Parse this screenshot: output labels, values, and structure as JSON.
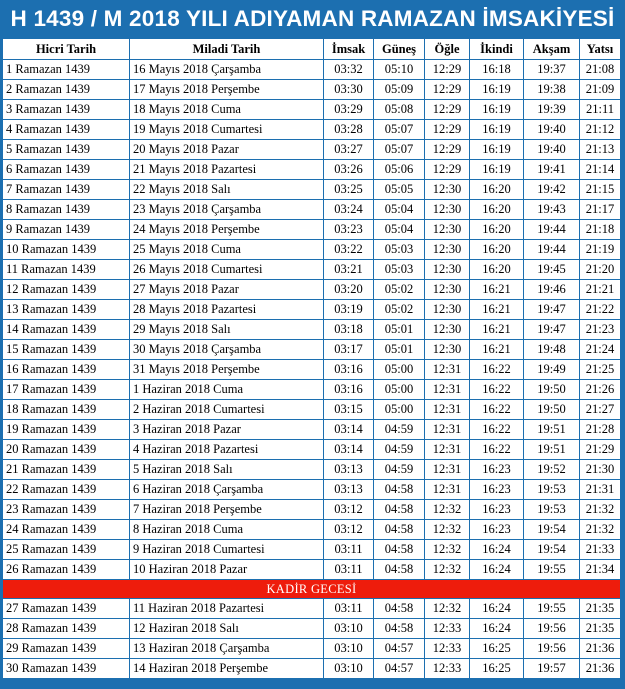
{
  "title": "H 1439 / M 2018 YILI ADIYAMAN RAMAZAN İMSAKİYESİ",
  "headers": {
    "hijri": "Hicri Tarih",
    "gregorian": "Miladi Tarih",
    "imsak": "İmsak",
    "gunes": "Güneş",
    "ogle": "Öğle",
    "ikindi": "İkindi",
    "aksam": "Akşam",
    "yatsi": "Yatsı"
  },
  "special_row": {
    "after_index": 25,
    "label": "KADİR GECESİ"
  },
  "rows": [
    {
      "hijri": "1 Ramazan 1439",
      "gregorian": "16 Mayıs 2018 Çarşamba",
      "imsak": "03:32",
      "gunes": "05:10",
      "ogle": "12:29",
      "ikindi": "16:18",
      "aksam": "19:37",
      "yatsi": "21:08"
    },
    {
      "hijri": "2 Ramazan 1439",
      "gregorian": "17 Mayıs 2018 Perşembe",
      "imsak": "03:30",
      "gunes": "05:09",
      "ogle": "12:29",
      "ikindi": "16:19",
      "aksam": "19:38",
      "yatsi": "21:09"
    },
    {
      "hijri": "3 Ramazan 1439",
      "gregorian": "18 Mayıs 2018 Cuma",
      "imsak": "03:29",
      "gunes": "05:08",
      "ogle": "12:29",
      "ikindi": "16:19",
      "aksam": "19:39",
      "yatsi": "21:11"
    },
    {
      "hijri": "4 Ramazan 1439",
      "gregorian": "19 Mayıs 2018 Cumartesi",
      "imsak": "03:28",
      "gunes": "05:07",
      "ogle": "12:29",
      "ikindi": "16:19",
      "aksam": "19:40",
      "yatsi": "21:12"
    },
    {
      "hijri": "5 Ramazan 1439",
      "gregorian": "20 Mayıs 2018 Pazar",
      "imsak": "03:27",
      "gunes": "05:07",
      "ogle": "12:29",
      "ikindi": "16:19",
      "aksam": "19:40",
      "yatsi": "21:13"
    },
    {
      "hijri": "6 Ramazan 1439",
      "gregorian": "21 Mayıs 2018 Pazartesi",
      "imsak": "03:26",
      "gunes": "05:06",
      "ogle": "12:29",
      "ikindi": "16:19",
      "aksam": "19:41",
      "yatsi": "21:14"
    },
    {
      "hijri": "7 Ramazan 1439",
      "gregorian": "22 Mayıs 2018 Salı",
      "imsak": "03:25",
      "gunes": "05:05",
      "ogle": "12:30",
      "ikindi": "16:20",
      "aksam": "19:42",
      "yatsi": "21:15"
    },
    {
      "hijri": "8 Ramazan 1439",
      "gregorian": "23 Mayıs 2018 Çarşamba",
      "imsak": "03:24",
      "gunes": "05:04",
      "ogle": "12:30",
      "ikindi": "16:20",
      "aksam": "19:43",
      "yatsi": "21:17"
    },
    {
      "hijri": "9 Ramazan 1439",
      "gregorian": "24 Mayıs 2018 Perşembe",
      "imsak": "03:23",
      "gunes": "05:04",
      "ogle": "12:30",
      "ikindi": "16:20",
      "aksam": "19:44",
      "yatsi": "21:18"
    },
    {
      "hijri": "10 Ramazan 1439",
      "gregorian": "25 Mayıs 2018 Cuma",
      "imsak": "03:22",
      "gunes": "05:03",
      "ogle": "12:30",
      "ikindi": "16:20",
      "aksam": "19:44",
      "yatsi": "21:19"
    },
    {
      "hijri": "11 Ramazan 1439",
      "gregorian": "26 Mayıs 2018 Cumartesi",
      "imsak": "03:21",
      "gunes": "05:03",
      "ogle": "12:30",
      "ikindi": "16:20",
      "aksam": "19:45",
      "yatsi": "21:20"
    },
    {
      "hijri": "12 Ramazan 1439",
      "gregorian": "27 Mayıs 2018 Pazar",
      "imsak": "03:20",
      "gunes": "05:02",
      "ogle": "12:30",
      "ikindi": "16:21",
      "aksam": "19:46",
      "yatsi": "21:21"
    },
    {
      "hijri": "13 Ramazan 1439",
      "gregorian": "28 Mayıs 2018 Pazartesi",
      "imsak": "03:19",
      "gunes": "05:02",
      "ogle": "12:30",
      "ikindi": "16:21",
      "aksam": "19:47",
      "yatsi": "21:22"
    },
    {
      "hijri": "14 Ramazan 1439",
      "gregorian": "29 Mayıs 2018 Salı",
      "imsak": "03:18",
      "gunes": "05:01",
      "ogle": "12:30",
      "ikindi": "16:21",
      "aksam": "19:47",
      "yatsi": "21:23"
    },
    {
      "hijri": "15 Ramazan 1439",
      "gregorian": "30 Mayıs 2018 Çarşamba",
      "imsak": "03:17",
      "gunes": "05:01",
      "ogle": "12:30",
      "ikindi": "16:21",
      "aksam": "19:48",
      "yatsi": "21:24"
    },
    {
      "hijri": "16 Ramazan 1439",
      "gregorian": "31 Mayıs 2018 Perşembe",
      "imsak": "03:16",
      "gunes": "05:00",
      "ogle": "12:31",
      "ikindi": "16:22",
      "aksam": "19:49",
      "yatsi": "21:25"
    },
    {
      "hijri": "17 Ramazan 1439",
      "gregorian": "1 Haziran 2018 Cuma",
      "imsak": "03:16",
      "gunes": "05:00",
      "ogle": "12:31",
      "ikindi": "16:22",
      "aksam": "19:50",
      "yatsi": "21:26"
    },
    {
      "hijri": "18 Ramazan 1439",
      "gregorian": "2 Haziran 2018 Cumartesi",
      "imsak": "03:15",
      "gunes": "05:00",
      "ogle": "12:31",
      "ikindi": "16:22",
      "aksam": "19:50",
      "yatsi": "21:27"
    },
    {
      "hijri": "19 Ramazan 1439",
      "gregorian": "3 Haziran 2018 Pazar",
      "imsak": "03:14",
      "gunes": "04:59",
      "ogle": "12:31",
      "ikindi": "16:22",
      "aksam": "19:51",
      "yatsi": "21:28"
    },
    {
      "hijri": "20 Ramazan 1439",
      "gregorian": "4 Haziran 2018 Pazartesi",
      "imsak": "03:14",
      "gunes": "04:59",
      "ogle": "12:31",
      "ikindi": "16:22",
      "aksam": "19:51",
      "yatsi": "21:29"
    },
    {
      "hijri": "21 Ramazan 1439",
      "gregorian": "5 Haziran 2018 Salı",
      "imsak": "03:13",
      "gunes": "04:59",
      "ogle": "12:31",
      "ikindi": "16:23",
      "aksam": "19:52",
      "yatsi": "21:30"
    },
    {
      "hijri": "22 Ramazan 1439",
      "gregorian": "6 Haziran 2018 Çarşamba",
      "imsak": "03:13",
      "gunes": "04:58",
      "ogle": "12:31",
      "ikindi": "16:23",
      "aksam": "19:53",
      "yatsi": "21:31"
    },
    {
      "hijri": "23 Ramazan 1439",
      "gregorian": "7 Haziran 2018 Perşembe",
      "imsak": "03:12",
      "gunes": "04:58",
      "ogle": "12:32",
      "ikindi": "16:23",
      "aksam": "19:53",
      "yatsi": "21:32"
    },
    {
      "hijri": "24 Ramazan 1439",
      "gregorian": "8 Haziran 2018 Cuma",
      "imsak": "03:12",
      "gunes": "04:58",
      "ogle": "12:32",
      "ikindi": "16:23",
      "aksam": "19:54",
      "yatsi": "21:32"
    },
    {
      "hijri": "25 Ramazan 1439",
      "gregorian": "9 Haziran 2018 Cumartesi",
      "imsak": "03:11",
      "gunes": "04:58",
      "ogle": "12:32",
      "ikindi": "16:24",
      "aksam": "19:54",
      "yatsi": "21:33"
    },
    {
      "hijri": "26 Ramazan 1439",
      "gregorian": "10 Haziran 2018 Pazar",
      "imsak": "03:11",
      "gunes": "04:58",
      "ogle": "12:32",
      "ikindi": "16:24",
      "aksam": "19:55",
      "yatsi": "21:34"
    },
    {
      "hijri": "27 Ramazan 1439",
      "gregorian": "11 Haziran 2018 Pazartesi",
      "imsak": "03:11",
      "gunes": "04:58",
      "ogle": "12:32",
      "ikindi": "16:24",
      "aksam": "19:55",
      "yatsi": "21:35"
    },
    {
      "hijri": "28 Ramazan 1439",
      "gregorian": "12 Haziran 2018 Salı",
      "imsak": "03:10",
      "gunes": "04:58",
      "ogle": "12:33",
      "ikindi": "16:24",
      "aksam": "19:56",
      "yatsi": "21:35"
    },
    {
      "hijri": "29 Ramazan 1439",
      "gregorian": "13 Haziran 2018 Çarşamba",
      "imsak": "03:10",
      "gunes": "04:57",
      "ogle": "12:33",
      "ikindi": "16:25",
      "aksam": "19:56",
      "yatsi": "21:36"
    },
    {
      "hijri": "30 Ramazan 1439",
      "gregorian": "14 Haziran 2018 Perşembe",
      "imsak": "03:10",
      "gunes": "04:57",
      "ogle": "12:33",
      "ikindi": "16:25",
      "aksam": "19:57",
      "yatsi": "21:36"
    }
  ]
}
